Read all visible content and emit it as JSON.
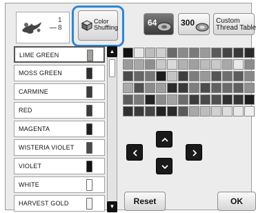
{
  "preview": {
    "thread_label_partial": "1\n8"
  },
  "toolbar": {
    "color_shuffling_label": "Color\nShuffling",
    "palette_64_label": "64",
    "palette_300_label": "300",
    "custom_thread_table_label": "Custom\nThread Table"
  },
  "thread_list": [
    {
      "name": "LIME GREEN",
      "spool_color": "#9ea39a",
      "selected": true
    },
    {
      "name": "MOSS GREEN",
      "spool_color": "#2e2e2e"
    },
    {
      "name": "CARMINE",
      "spool_color": "#3c3c3c"
    },
    {
      "name": "RED",
      "spool_color": "#3a3a3a"
    },
    {
      "name": "MAGENTA",
      "spool_color": "#1f1f1f"
    },
    {
      "name": "WISTERIA VIOLET",
      "spool_color": "#4a4a4a"
    },
    {
      "name": "VIOLET",
      "spool_color": "#121212"
    },
    {
      "name": "WHITE",
      "spool_color": "#ffffff"
    },
    {
      "name": "HARVEST GOLD",
      "spool_color": "#f4f4f4"
    }
  ],
  "palette_rows": [
    [
      "#111111",
      "#e8e8e8",
      "#bdbdbd",
      "#cfcfcf",
      "#6a6a6a",
      "#8a8a8a",
      "#7a7a7a",
      "#9a9a9a",
      "#5a5a5a",
      "#454545",
      "#383838",
      "#2a2a2a"
    ],
    [
      "#9a9a9a",
      "#a8a8a8",
      "#8f8f8f",
      "#c8c8c8",
      "#d9d9d9",
      "#b2b2b2",
      "#a0a0a0",
      "#bcbcbc",
      "#c9c9c9",
      "#a9a9a9",
      "#e9e9e9",
      "#8c8c8c"
    ],
    [
      "#4b4b4b",
      "#666666",
      "#777777",
      "#1c1c1c",
      "#c4c4c4",
      "#3f3f3f",
      "#7d7d7d",
      "#999999",
      "#555555",
      "#6e6e6e",
      "#5c5c5c",
      "#888888"
    ],
    [
      "#aaaaaa",
      "#505050",
      "#8b8b8b",
      "#9e9e9e",
      "#2c2c2c",
      "#3a3a3a",
      "#7e7e7e",
      "#4c4c4c",
      "#626262",
      "#6b6b6b",
      "#5f5f5f",
      "#909090"
    ],
    [
      "#5e5e5e",
      "#7a7a7a",
      "#242424",
      "#8a8a8a",
      "#a3a3a3",
      "#6c6c6c",
      "#3d3d3d",
      "#4a4a4a",
      "#4f4f4f",
      "#2f2f2f",
      "#353535",
      "#1e1e1e"
    ],
    [
      "#303030",
      "#3b3b3b",
      "#454545",
      "#222222",
      "#2a2a2a",
      "#5a5a5a",
      "#a8a8a8",
      "#bdbdbd",
      "#d0d0d0",
      "#dddddd",
      "#e8e8e8",
      "#efefef"
    ]
  ],
  "actions": {
    "reset_label": "Reset",
    "ok_label": "OK"
  }
}
